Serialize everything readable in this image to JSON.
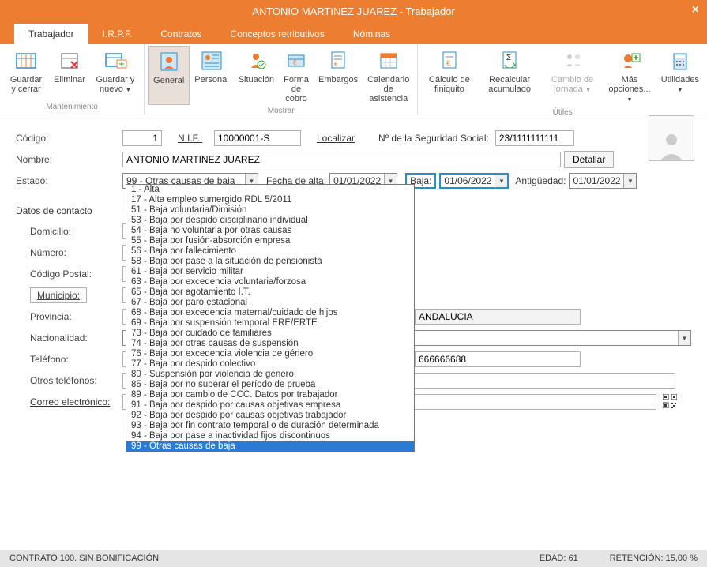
{
  "window": {
    "title": "ANTONIO MARTINEZ JUAREZ - Trabajador"
  },
  "tabs": [
    {
      "label": "Trabajador",
      "active": true
    },
    {
      "label": "I.R.P.F."
    },
    {
      "label": "Contratos"
    },
    {
      "label": "Conceptos retributivos"
    },
    {
      "label": "Nóminas"
    }
  ],
  "ribbon": {
    "groups": [
      {
        "label": "Mantenimiento",
        "buttons": [
          {
            "name": "guardar-cerrar",
            "label": "Guardar y cerrar"
          },
          {
            "name": "eliminar",
            "label": "Eliminar"
          },
          {
            "name": "guardar-nuevo",
            "label": "Guardar y nuevo",
            "dropdown": true
          }
        ]
      },
      {
        "label": "Mostrar",
        "buttons": [
          {
            "name": "general",
            "label": "General",
            "active": true
          },
          {
            "name": "personal",
            "label": "Personal"
          },
          {
            "name": "situacion",
            "label": "Situación"
          },
          {
            "name": "forma-cobro",
            "label": "Forma de cobro"
          },
          {
            "name": "embargos",
            "label": "Embargos"
          },
          {
            "name": "calendario-asistencia",
            "label": "Calendario de asistencia"
          }
        ]
      },
      {
        "label": "Útiles",
        "buttons": [
          {
            "name": "calculo-finiquito",
            "label": "Cálculo de finiquito"
          },
          {
            "name": "recalcular-acumulado",
            "label": "Recalcular acumulado"
          },
          {
            "name": "cambio-jornada",
            "label": "Cambio de jornada",
            "disabled": true,
            "dropdown": true
          },
          {
            "name": "mas-opciones",
            "label": "Más opciones...",
            "dropdown": true
          },
          {
            "name": "utilidades",
            "label": "Utilidades",
            "dropdown": true
          }
        ]
      }
    ]
  },
  "form": {
    "codigo_label": "Código:",
    "codigo_value": "1",
    "nif_label": "N.I.F.:",
    "nif_value": "10000001-S",
    "localizar": "Localizar",
    "nss_label": "Nº de la Seguridad Social:",
    "nss_value": "23/1111111111",
    "nombre_label": "Nombre:",
    "nombre_value": "ANTONIO MARTINEZ JUAREZ",
    "detallar": "Detallar",
    "estado_label": "Estado:",
    "estado_value": "99 - Otras causas de baja",
    "fecha_alta_label": "Fecha de alta:",
    "fecha_alta_value": "01/01/2022",
    "baja_label": "Baja:",
    "baja_value": "01/06/2022",
    "antiguedad_label": "Antigüedad:",
    "antiguedad_value": "01/01/2022",
    "datos_contacto_title": "Datos de contacto",
    "domicilio_label": "Domicilio:",
    "numero_label": "Número:",
    "codigo_postal_label": "Código Postal:",
    "municipio_btn": "Municipio:",
    "provincia_label": "Provincia:",
    "provincia_extra": "ANDALUCIA",
    "nacionalidad_label": "Nacionalidad:",
    "telefono_label": "Teléfono:",
    "telefono_extra": "666666688",
    "otros_telefonos_label": "Otros teléfonos:",
    "correo_label": "Correo electrónico:"
  },
  "estado_options": [
    "1 - Alta",
    "17 - Alta empleo sumergido RDL 5/2011",
    "51 - Baja voluntaria/Dimisión",
    "53 - Baja por despido disciplinario individual",
    "54 - Baja no voluntaria por otras causas",
    "55 - Baja por fusión-absorción empresa",
    "56 - Baja por fallecimiento",
    "58 - Baja por pase a la situación de pensionista",
    "61 - Baja por servicio militar",
    "63 - Baja por excedencia voluntaria/forzosa",
    "65 - Baja por agotamiento I.T.",
    "67 - Baja por paro estacional",
    "68 - Baja por excedencia maternal/cuidado de hijos",
    "69 - Baja por suspensión temporal ERE/ERTE",
    "73 - Baja por cuidado de familiares",
    "74 - Baja por otras causas de suspensión",
    "76 - Baja por excedencia violencia de género",
    "77 - Baja por despido colectivo",
    "80 - Suspensión por violencia de género",
    "85 - Baja por no superar el período de prueba",
    "89 - Baja por cambio de CCC. Datos por trabajador",
    "91 - Baja por despido por causas objetivas empresa",
    "92 - Baja por despido por causas objetivas trabajador",
    "93 - Baja por fin contrato temporal o de duración determinada",
    "94 - Baja por pase a inactividad fijos discontinuos",
    "99 - Otras causas de baja"
  ],
  "statusbar": {
    "contrato": "CONTRATO 100.  SIN BONIFICACIÓN",
    "edad": "EDAD: 61",
    "retencion": "RETENCIÓN: 15,00 %"
  }
}
